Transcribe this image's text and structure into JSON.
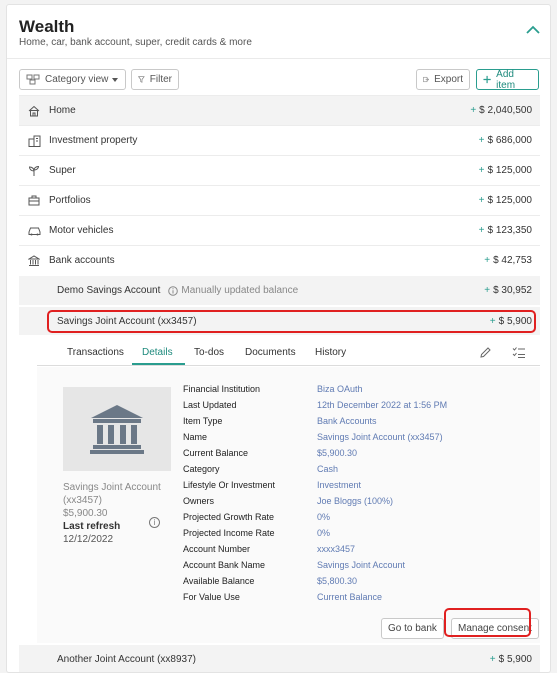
{
  "header": {
    "title": "Wealth",
    "subtitle": "Home, car, bank account, super, credit cards & more"
  },
  "toolbar": {
    "view_label": "Category view",
    "filter_label": "Filter",
    "export_label": "Export",
    "add_label": "Add item"
  },
  "categories": [
    {
      "label": "Home",
      "amount": "$ 2,040,500",
      "icon": "house-icon"
    },
    {
      "label": "Investment property",
      "amount": "$ 686,000",
      "icon": "buildings-icon"
    },
    {
      "label": "Super",
      "amount": "$ 125,000",
      "icon": "sprout-icon"
    },
    {
      "label": "Portfolios",
      "amount": "$ 125,000",
      "icon": "briefcase-icon"
    },
    {
      "label": "Motor vehicles",
      "amount": "$ 123,350",
      "icon": "car-icon"
    },
    {
      "label": "Bank accounts",
      "amount": "$ 42,753",
      "icon": "bank-icon"
    }
  ],
  "accounts": [
    {
      "label": "Demo Savings Account",
      "note": "Manually updated balance",
      "amount": "$ 30,952"
    },
    {
      "label": "Savings Joint Account (xx3457)",
      "amount": "$ 5,900"
    },
    {
      "label": "Another Joint Account (xx8937)",
      "amount": "$ 5,900"
    }
  ],
  "tabs": [
    "Transactions",
    "Details",
    "To-dos",
    "Documents",
    "History"
  ],
  "active_tab": "Details",
  "summary": {
    "name_line1": "Savings Joint Account",
    "name_line2": "(xx3457)",
    "balance": "$5,900.30",
    "last_refresh_label": "Last refresh",
    "last_refresh_date": "12/12/2022"
  },
  "details": [
    {
      "key": "Financial Institution",
      "value": "Biza OAuth"
    },
    {
      "key": "Last Updated",
      "value": "12th December 2022 at 1:56 PM"
    },
    {
      "key": "Item Type",
      "value": "Bank Accounts"
    },
    {
      "key": "Name",
      "value": "Savings Joint Account (xx3457)"
    },
    {
      "key": "Current Balance",
      "value": "$5,900.30"
    },
    {
      "key": "Category",
      "value": "Cash"
    },
    {
      "key": "Lifestyle Or Investment",
      "value": "Investment"
    },
    {
      "key": "Owners",
      "value": "Joe Bloggs (100%)"
    },
    {
      "key": "Projected Growth Rate",
      "value": "0%"
    },
    {
      "key": "Projected Income Rate",
      "value": "0%"
    },
    {
      "key": "Account Number",
      "value": "xxxx3457"
    },
    {
      "key": "Account Bank Name",
      "value": "Savings Joint Account"
    },
    {
      "key": "Available Balance",
      "value": "$5,800.30"
    },
    {
      "key": "For Value Use",
      "value": "Current Balance"
    }
  ],
  "actions": {
    "go_to_bank": "Go to bank",
    "manage_consent": "Manage consent"
  },
  "colors": {
    "accent": "#2a9d8f",
    "highlight": "#e02020",
    "value_text": "#607bb3"
  }
}
